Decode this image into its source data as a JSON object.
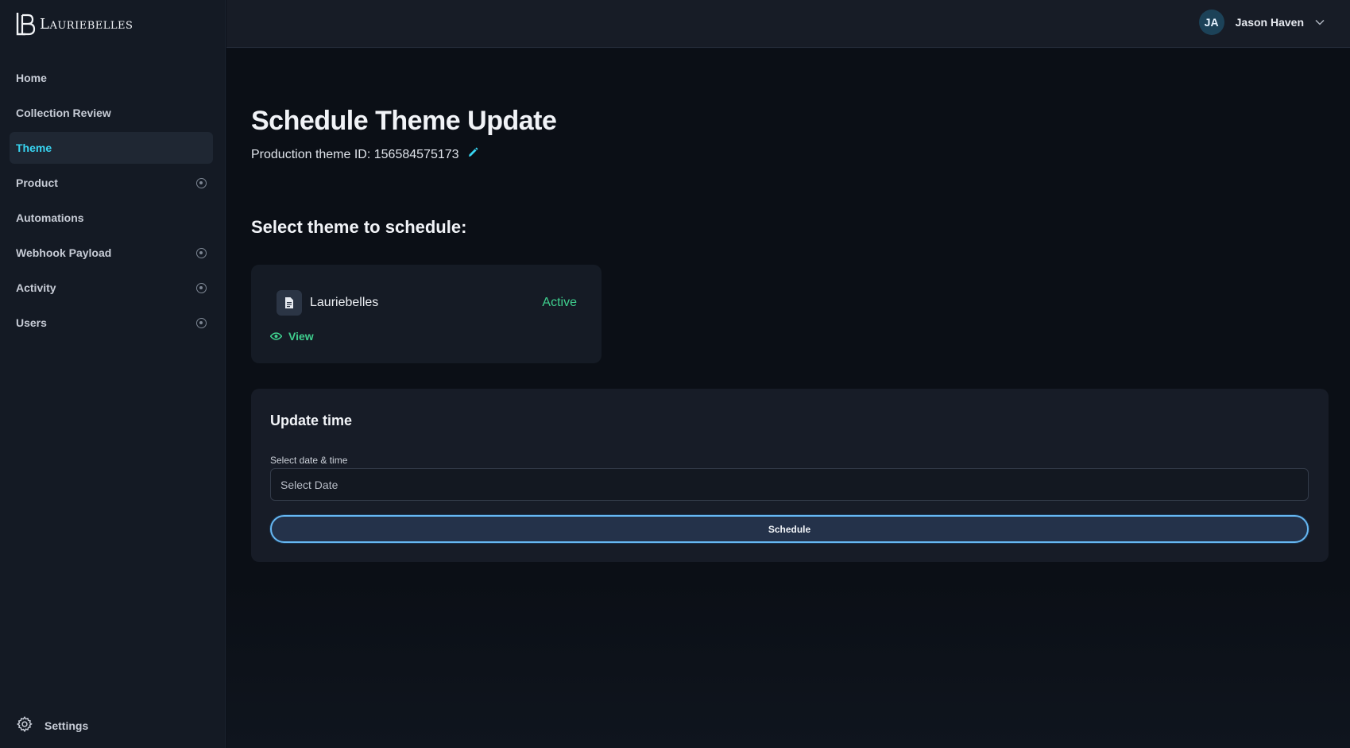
{
  "brand": {
    "name": "Lauriebelles"
  },
  "sidebar": {
    "items": [
      {
        "label": "Home",
        "active": false,
        "expandable": false
      },
      {
        "label": "Collection Review",
        "active": false,
        "expandable": false
      },
      {
        "label": "Theme",
        "active": true,
        "expandable": false
      },
      {
        "label": "Product",
        "active": false,
        "expandable": true
      },
      {
        "label": "Automations",
        "active": false,
        "expandable": false
      },
      {
        "label": "Webhook Payload",
        "active": false,
        "expandable": true
      },
      {
        "label": "Activity",
        "active": false,
        "expandable": true
      },
      {
        "label": "Users",
        "active": false,
        "expandable": true
      }
    ],
    "settings_label": "Settings",
    "settings_icon": "gear-icon"
  },
  "header": {
    "user": {
      "initials": "JA",
      "name": "Jason Haven"
    },
    "dropdown_icon": "chevron-down-icon"
  },
  "main": {
    "title": "Schedule Theme Update",
    "theme_id_label": "Production theme ID:",
    "theme_id": "156584575173",
    "edit_icon": "pencil-icon",
    "section_title": "Select theme to schedule:",
    "theme_card": {
      "name": "Lauriebelles",
      "status": "Active",
      "view_label": "View",
      "icon": "document-icon"
    },
    "update_time": {
      "title": "Update time",
      "field_label": "Select date & time",
      "placeholder": "Select Date",
      "button_label": "Schedule"
    }
  },
  "colors": {
    "accent_active": "#38d5f2",
    "status_green": "#3fcf8e",
    "button_border": "#66b7f2",
    "sidebar_bg": "#141a24",
    "main_bg": "#0b0f16"
  }
}
